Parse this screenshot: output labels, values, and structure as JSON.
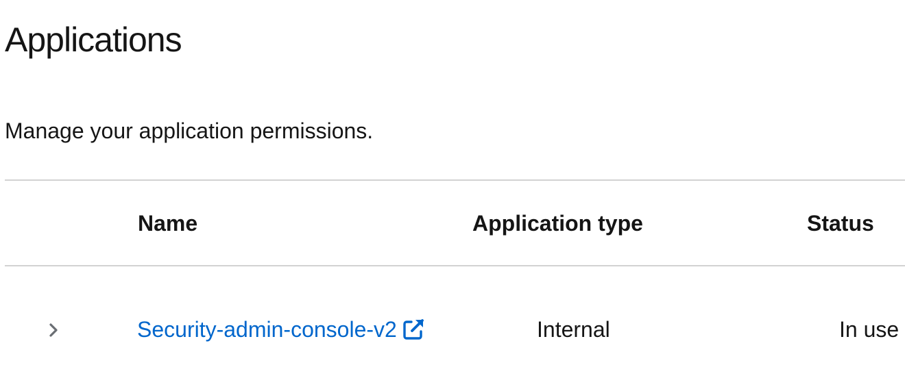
{
  "page": {
    "title": "Applications",
    "description": "Manage your application permissions."
  },
  "table": {
    "columns": [
      "Name",
      "Application type",
      "Status"
    ],
    "rows": [
      {
        "name": "Security-admin-console-v2",
        "type": "Internal",
        "status": "In use",
        "expanded": false
      }
    ]
  },
  "icons": {
    "expand": "chevron-right-icon",
    "external_link": "external-link-icon"
  },
  "colors": {
    "link": "#0066cc",
    "text": "#151515",
    "divider": "#d2d2d2",
    "chevron": "#6a6e73"
  }
}
